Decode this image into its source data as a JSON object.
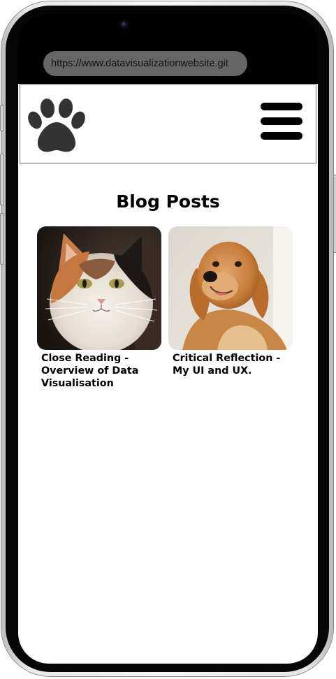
{
  "browser": {
    "url": "https://www.datavisualizationwebsite.git"
  },
  "header": {
    "logo_icon": "paw-print-icon",
    "menu_icon": "hamburger-menu-icon"
  },
  "main": {
    "title": "Blog Posts",
    "posts": [
      {
        "title_line1": "Close Reading -",
        "title_line2": "Overview of Data",
        "title_line3": "Visualisation",
        "image": "calico-cat-photo"
      },
      {
        "title_line1": "Critical Reflection -",
        "title_line2": "My UI and UX.",
        "image": "golden-retriever-photo"
      }
    ]
  },
  "colors": {
    "frame_bezel": "#050505",
    "urlbar_bg": "#666666",
    "text": "#000000",
    "background": "#ffffff"
  }
}
